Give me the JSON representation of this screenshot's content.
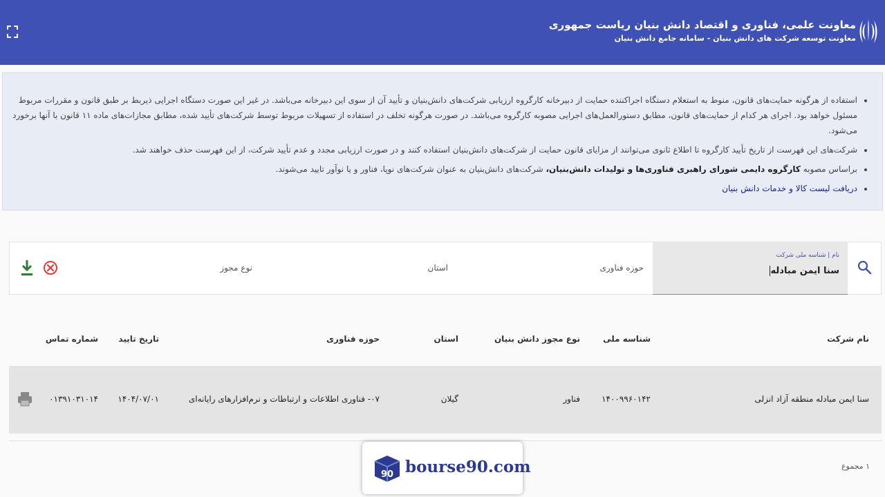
{
  "header": {
    "title": "معاونت علمی، فناوری و اقتصاد دانش بنیان ریاست جمهوری",
    "subtitle": "معاونت توسعه شرکت های دانش بنیان - سامانه جامع دانش بنیان"
  },
  "notice": {
    "item1": "استفاده از هرگونه حمایت‌های قانون، منوط به استعلام دستگاه اجراکننده حمایت از دبیرخانه کارگروه ارزیابی شرکت‌های دانش‌بنیان و تأیید آن از سوی این دبیرخانه می‌باشد. در غیر این صورت دستگاه اجرایی ذیربط بر طبق قانون و مقررات مربوط مسئول خواهد بود. اجرای هر کدام از حمایت‌های قانون، مطابق دستورالعمل‌های اجرایی مصوبه کارگروه می‌باشد. در صورت هرگونه تخلف در استفاده از تسهیلات مربوط توسط شرکت‌های تأیید شده، مطابق مجازات‌های ماده ۱۱ قانون با آنها برخورد می‌شود.",
    "item2": "شرکت‌های این فهرست از تاریخ تأیید کارگروه تا اطلاع ثانوی می‌توانند از مزایای قانون حمایت از شرکت‌های دانش‌بنیان استفاده کنند و در صورت ارزیابی مجدد و عدم تأیید شرکت، از این فهرست حذف خواهند شد.",
    "item3_prefix": "براساس مصوبه",
    "item3_bold": "کارگروه دایمی شورای راهبری فناوری‌ها و تولیدات دانش‌بنیان،",
    "item3_suffix": "شرکت‌های دانش‌بنیان به عنوان شرکت‌های نوپا، فناور و یا نوآور تایید می‌شوند.",
    "item4_link": "دریافت لیست کالا و خدمات دانش بنیان"
  },
  "search": {
    "name_label": "نام | شناسه ملی شرکت",
    "name_value": "سنا ایمن مبادله",
    "tech_field": "حوزه فناوری",
    "province": "استان",
    "license_type": "نوع مجوز"
  },
  "table": {
    "headers": {
      "company": "نام شرکت",
      "national_id": "شناسه ملی",
      "license": "نوع مجوز دانش بنیان",
      "province": "استان",
      "field": "حوزه فناوری",
      "date": "تاریخ تایید",
      "phone": "شماره تماس"
    },
    "row": {
      "company": "سنا ایمن مبادله منطقه آزاد انزلی",
      "national_id": "۱۴۰۰۹۹۶۰۱۴۲",
      "license": "فناور",
      "province": "گیلان",
      "field": "۰۷- فناوری اطلاعات و ارتباطات و نرم‌افزارهای رایانه‌ای",
      "date": "۱۴۰۴/۰۷/۰۱",
      "phone": "۰۱۳۹۱۰۳۱۰۱۴"
    }
  },
  "footer": {
    "total": "۱ مجموع"
  },
  "watermark": {
    "text": "bourse90.com",
    "logo_text": "90"
  },
  "colors": {
    "header_bg": "#3f51b5",
    "notice_bg": "#e7ecf5",
    "row_bg": "#e4e4e4",
    "download_green": "#2e7d32",
    "clear_red": "#e53935"
  }
}
